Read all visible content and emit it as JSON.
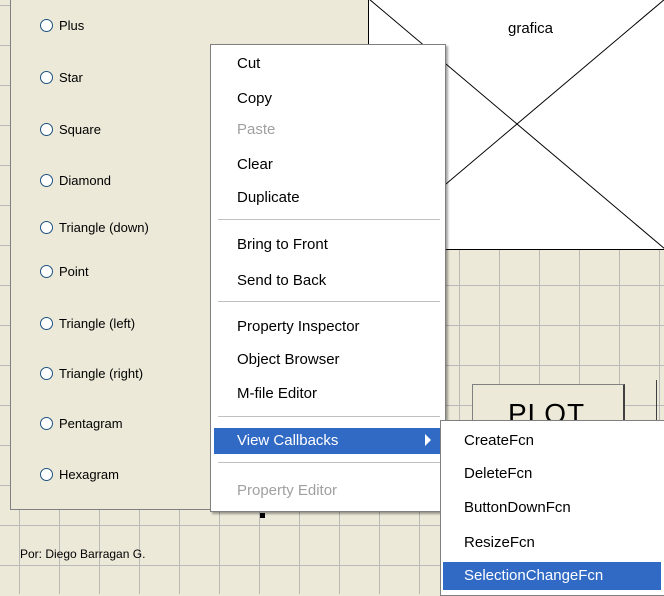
{
  "radio_options": [
    "Plus",
    "Star",
    "Square",
    "Diamond",
    "Triangle (down)",
    "Point",
    "Triangle (left)",
    "Triangle (right)",
    "Pentagram",
    "Hexagram"
  ],
  "author_label": "Por: Diego Barragan G.",
  "axes_title": "grafica",
  "plot_button_label": "PLOT",
  "context_menu": {
    "cut": "Cut",
    "copy": "Copy",
    "paste": "Paste",
    "clear": "Clear",
    "duplicate": "Duplicate",
    "bring_to_front": "Bring to Front",
    "send_to_back": "Send to Back",
    "property_inspector": "Property Inspector",
    "object_browser": "Object Browser",
    "mfile_editor": "M-file Editor",
    "view_callbacks": "View Callbacks",
    "property_editor": "Property Editor"
  },
  "submenu": {
    "items": [
      "CreateFcn",
      "DeleteFcn",
      "ButtonDownFcn",
      "ResizeFcn",
      "SelectionChangeFcn"
    ]
  },
  "colors": {
    "highlight": "#316ac5",
    "panel_bg": "#ece9d8",
    "disabled_text": "#a0a0a0",
    "radio_border": "#1c5180"
  }
}
